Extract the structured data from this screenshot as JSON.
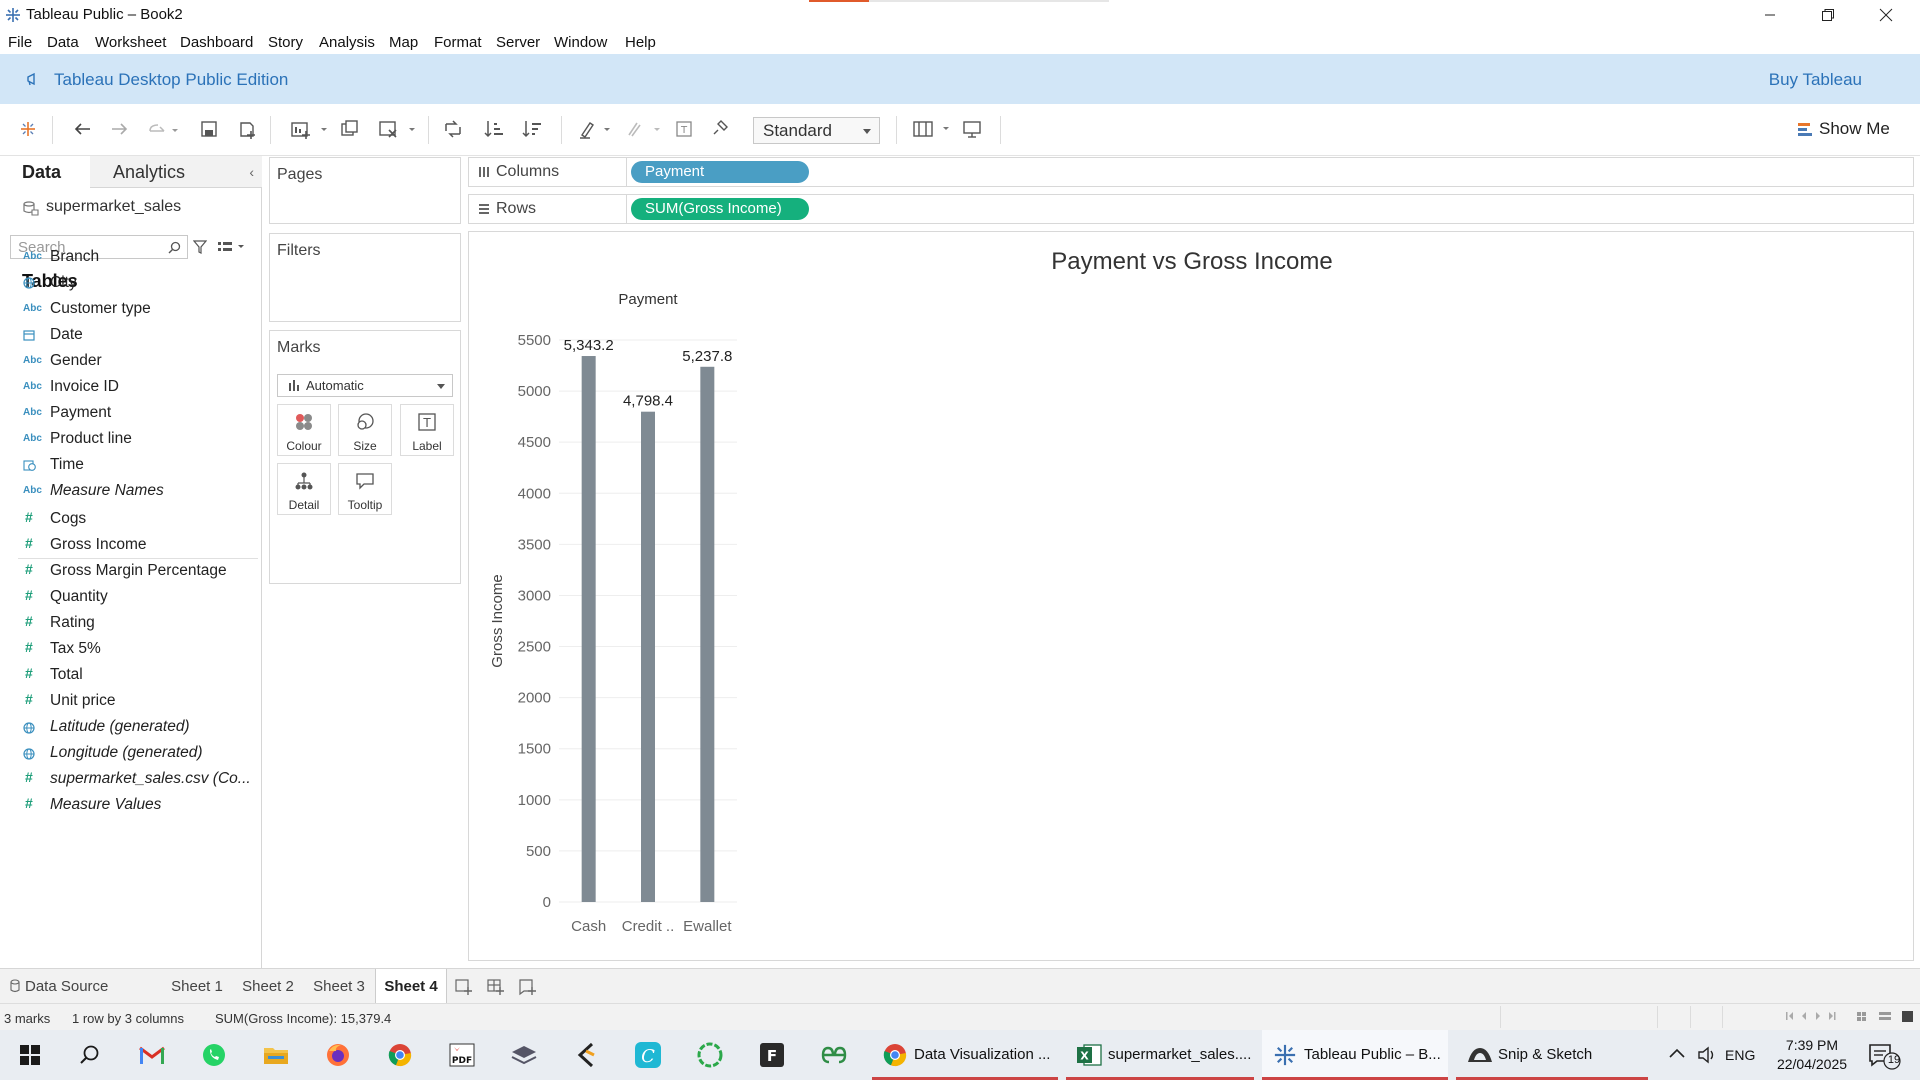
{
  "window": {
    "title": "Tableau Public – Book2"
  },
  "menu": [
    "File",
    "Data",
    "Worksheet",
    "Dashboard",
    "Story",
    "Analysis",
    "Map",
    "Format",
    "Server",
    "Window",
    "Help"
  ],
  "banner": {
    "edition": "Tableau Desktop Public Edition",
    "buy": "Buy Tableau"
  },
  "toolbar": {
    "fit_select": "Standard",
    "show_me": "Show Me"
  },
  "data_pane": {
    "tab_data": "Data",
    "tab_analytics": "Analytics",
    "collapse": "‹",
    "data_source": "supermarket_sales",
    "search_placeholder": "Search",
    "tables_heading": "Tables",
    "dimensions": [
      {
        "type": "Abc",
        "name": "Branch"
      },
      {
        "type": "geo",
        "name": "City"
      },
      {
        "type": "Abc",
        "name": "Customer type"
      },
      {
        "type": "date",
        "name": "Date"
      },
      {
        "type": "Abc",
        "name": "Gender"
      },
      {
        "type": "Abc",
        "name": "Invoice ID"
      },
      {
        "type": "Abc",
        "name": "Payment"
      },
      {
        "type": "Abc",
        "name": "Product line"
      },
      {
        "type": "time",
        "name": "Time"
      },
      {
        "type": "Abc",
        "name": "Measure Names",
        "italic": true
      }
    ],
    "measures": [
      {
        "type": "#",
        "name": "Cogs"
      },
      {
        "type": "#",
        "name": "Gross Income"
      },
      {
        "type": "#",
        "name": "Gross Margin Percentage"
      },
      {
        "type": "#",
        "name": "Quantity"
      },
      {
        "type": "#",
        "name": "Rating"
      },
      {
        "type": "#",
        "name": "Tax 5%"
      },
      {
        "type": "#",
        "name": "Total"
      },
      {
        "type": "#",
        "name": "Unit price"
      },
      {
        "type": "geo",
        "name": "Latitude (generated)",
        "italic": true
      },
      {
        "type": "geo",
        "name": "Longitude (generated)",
        "italic": true
      },
      {
        "type": "#",
        "name": "supermarket_sales.csv (Co...",
        "italic": true
      },
      {
        "type": "#",
        "name": "Measure Values",
        "italic": true
      }
    ]
  },
  "cards": {
    "pages": "Pages",
    "filters": "Filters",
    "marks": "Marks",
    "marks_type": "Automatic",
    "mark_buttons": [
      "Colour",
      "Size",
      "Label",
      "Detail",
      "Tooltip"
    ]
  },
  "shelves": {
    "columns_label": "Columns",
    "columns_pill": "Payment",
    "rows_label": "Rows",
    "rows_pill": "SUM(Gross Income)"
  },
  "view": {
    "title": "Payment vs Gross Income"
  },
  "chart_data": {
    "type": "bar",
    "title": "Payment vs Gross Income",
    "column_header": "Payment",
    "categories": [
      "Cash",
      "Credit ..",
      "Ewallet"
    ],
    "values": [
      5343.2,
      4798.4,
      5237.8
    ],
    "value_labels": [
      "5,343.2",
      "4,798.4",
      "5,237.8"
    ],
    "ylabel": "Gross Income",
    "yticks": [
      0,
      500,
      1000,
      1500,
      2000,
      2500,
      3000,
      3500,
      4000,
      4500,
      5000,
      5500
    ],
    "ylim": [
      0,
      5500
    ],
    "bar_color": "#7f8a93",
    "grid": true
  },
  "sheet_tabs": {
    "data_source": "Data Source",
    "sheets": [
      "Sheet 1",
      "Sheet 2",
      "Sheet 3",
      "Sheet 4"
    ],
    "active": "Sheet 4"
  },
  "status": {
    "marks": "3 marks",
    "dims": "1 row by 3 columns",
    "sum": "SUM(Gross Income): 15,379.4"
  },
  "taskbar": {
    "apps": [
      {
        "label": "Data Visualization ..."
      },
      {
        "label": "supermarket_sales...."
      },
      {
        "label": "Tableau Public – B..."
      },
      {
        "label": "Snip & Sketch"
      }
    ],
    "lang": "ENG",
    "time": "7:39 PM",
    "date": "22/04/2025",
    "notif_count": "19"
  },
  "colors": {
    "banner_bg": "#d2e6f7",
    "banner_text": "#2b72b8",
    "dimension_pill": "#4a9ec4",
    "measure_pill": "#15b07d"
  }
}
